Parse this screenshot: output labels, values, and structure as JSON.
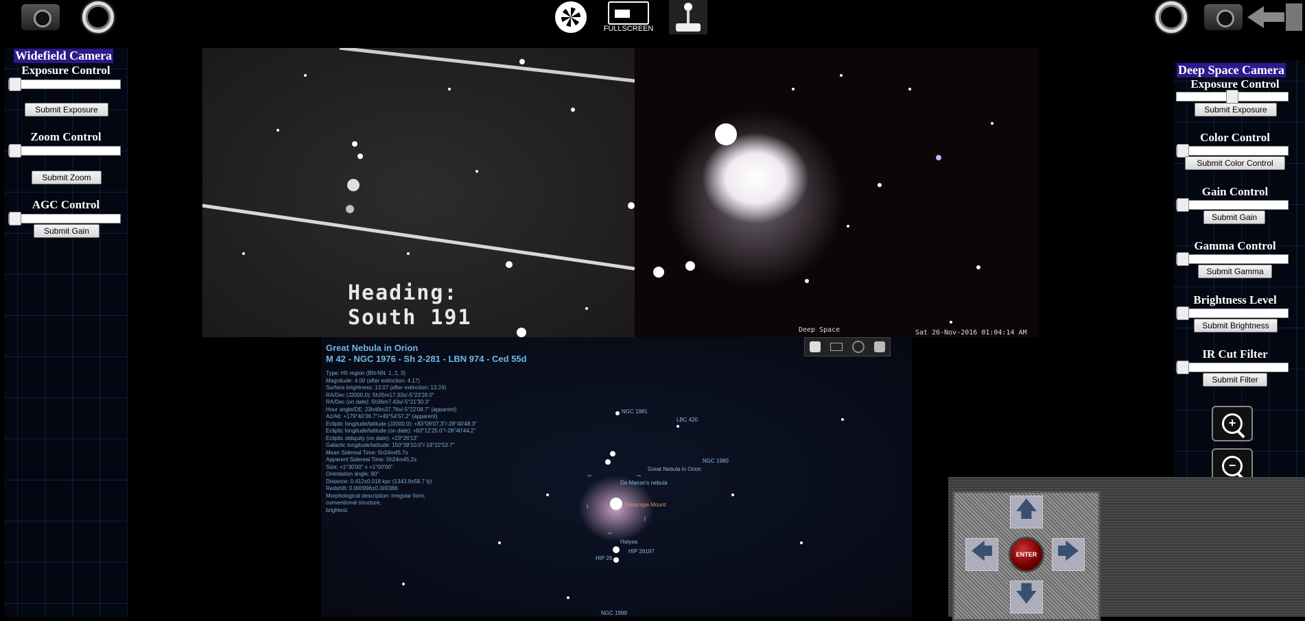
{
  "toolbar": {
    "fullscreen_label": "FULLSCREEN"
  },
  "widefield": {
    "title": "Widefield Camera",
    "exposure_label": "Exposure Control",
    "exposure_button": "Submit Exposure",
    "zoom_label": "Zoom Control",
    "zoom_button": "Submit Zoom",
    "agc_label": "AGC Control",
    "agc_button": "Submit Gain"
  },
  "deepspace": {
    "title": "Deep Space Camera",
    "exposure_label": "Exposure Control",
    "exposure_button": "Submit Exposure",
    "color_label": "Color Control",
    "color_button": "Submit Color Control",
    "gain_label": "Gain Control",
    "gain_button": "Submit Gain",
    "gamma_label": "Gamma Control",
    "gamma_button": "Submit Gamma",
    "brightness_label": "Brightness Level",
    "brightness_button": "Submit Brightness",
    "ircut_label": "IR Cut Filter",
    "ircut_button": "Submit Filter"
  },
  "video_widefield": {
    "heading_line1": "Heading:",
    "heading_line2": "South 191"
  },
  "video_deepspace": {
    "osd_left": "Deep Space",
    "osd_right": "Sat 26-Nov-2016 01:04:14 AM"
  },
  "planetarium": {
    "object_name": "Great Nebula in Orion",
    "designations": "M 42 - NGC 1976 - Sh 2-281 - LBN 974 - Ced 55d",
    "info_lines": [
      "Type: HII region (BN-NN: 1, 2, 3)",
      "Magnitude: 4.00 (after extinction: 4.17)",
      "Surface brightness: 13.07 (after extinction: 13.24)",
      "RA/Dec (J2000.0): 5h35m17.33s/-5°23'28.0\"",
      "RA/Dec (on date): 5h36m7.43s/-5°21'30.3\"",
      "Hour angle/DE: 23h48m37.76s/-5°22'08.7\" (apparent)",
      "Az/Alt: +179°40'36.7\"/+49°54'57.2\" (apparent)",
      "Ecliptic longitude/latitude (J2000.0): +83°09'07.3\"/-28°40'48.3\"",
      "Ecliptic longitude/latitude (on date): +83°12'25.0\"/-28°40'44.2\"",
      "Ecliptic obliquity (on date): +23°26'13\"",
      "Galactic longitude/latitude: 150°39'10.0\"/-19°22'53.7\"",
      "Mean Sidereal Time: 5h24m45.7s",
      "Apparent Sidereal Time: 5h24m45.2s",
      "Size: +1°30'00\" x +1°00'00\"",
      "Orientation angle: 90°",
      "Distance: 0.412±0.018 kpc (1343.9±58.7 ly)",
      "Redshift: 0.000996±0.000386",
      "Morphological description: irregular form,",
      "conventional structure,",
      "brightest."
    ],
    "labels": {
      "ngc1981": "NGC 1981",
      "lbc420": "LBC 420",
      "ngc1980": "NGC 1980",
      "great_nebula": "Great Nebula in Orion",
      "de_mairan": "De Mairan's nebula",
      "telescope_mount": "Telescope Mount",
      "hatysa": "Hatysa",
      "hip26197": "HIP 26197",
      "hip26xxx": "HIP 26…",
      "ngc1999": "NGC 1999"
    }
  },
  "dpad": {
    "enter_label": "ENTER"
  }
}
